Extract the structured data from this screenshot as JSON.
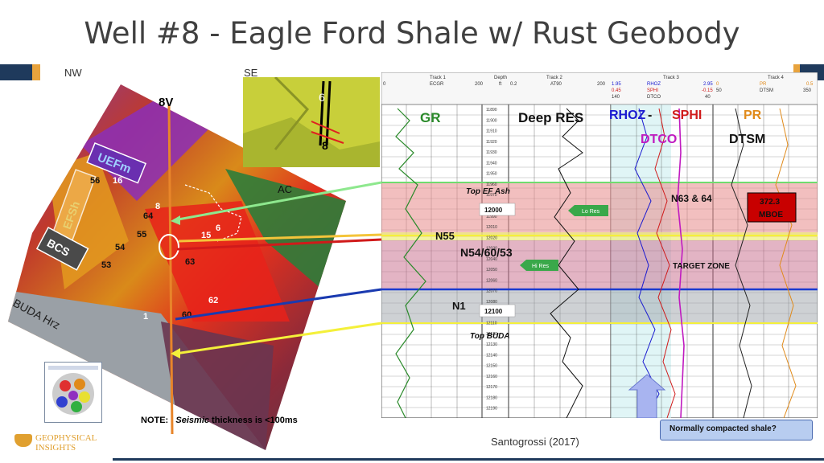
{
  "slide": {
    "title": "Well #8 - Eagle Ford Shale w/ Rust Geobody",
    "nw_label": "NW",
    "se_label": "SE",
    "note_prefix": "NOTE:",
    "note_italic": "Seismic",
    "note_rest": " thickness is <100ms",
    "citation": "Santogrossi (2017)",
    "logo_line1": "GEOPHYSICAL",
    "logo_line2": "INSIGHTS"
  },
  "seismic_map": {
    "well_label": "8V",
    "labels": [
      "UEFm",
      "EFSh",
      "BCS",
      "BUDA Hrz",
      "AC"
    ],
    "numbers": [
      "56",
      "16",
      "8",
      "64",
      "55",
      "54",
      "53",
      "6",
      "15",
      "63",
      "62",
      "1",
      "60"
    ]
  },
  "inset": {
    "labels": [
      "6",
      "8"
    ]
  },
  "well_log": {
    "track_headers": [
      "Track 1",
      "Depth",
      "Track 2",
      "Track 3",
      "Track 4"
    ],
    "curve_headers": [
      "ECGR",
      "ft",
      "AT90",
      "RHOZ",
      "SPHI",
      "DTCO",
      "PR",
      "DTSM"
    ],
    "scale_values": [
      "0",
      "200",
      "0.2",
      "200",
      "1.95",
      "2.95",
      "0.45",
      "-0.15",
      "140",
      "40",
      "0",
      "0.5",
      "50",
      "350"
    ],
    "big_labels": [
      "GR",
      "Deep RES",
      "RHOZ",
      " - ",
      "SPHI",
      "DTCO",
      "PR",
      "DTSM"
    ],
    "depths": [
      "11890",
      "11900",
      "11910",
      "11920",
      "11930",
      "11940",
      "11950",
      "11960",
      "11970",
      "11980",
      "11990",
      "12010",
      "12020",
      "12030",
      "12040",
      "12050",
      "12060",
      "12070",
      "12080",
      "12090",
      "12110",
      "12120",
      "12130",
      "12140",
      "12150",
      "12160",
      "12170",
      "12180",
      "12190"
    ],
    "depth_box_1": "12000",
    "depth_box_2": "12100",
    "zone_labels": [
      "Top EF Ash",
      "N63 & 64",
      "N55",
      "N54/60/53",
      "TARGET ZONE",
      "N1",
      "Top BUDA"
    ],
    "badges": [
      "Lo Res",
      "Hi Res"
    ],
    "red_box_line1": "372.3",
    "red_box_line2": "MBOE",
    "callout": "Normally compacted shale?"
  }
}
